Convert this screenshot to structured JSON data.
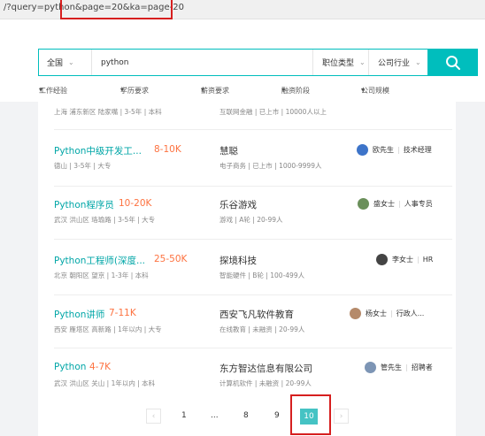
{
  "address_bar": {
    "url": "/?query=python&page=20&ka=page-20"
  },
  "search": {
    "city": "全国",
    "query": "python",
    "job_type": "职位类型",
    "industry": "公司行业",
    "icons": {
      "chevron": "chevron-down-icon",
      "search": "search-icon"
    }
  },
  "filters": [
    "工作经验",
    "学历要求",
    "薪资要求",
    "融资阶段",
    "公司规模"
  ],
  "partial_job": {
    "meta": "上海 浦东新区 陆家嘴 | 3-5年 | 本科",
    "company_meta": "互联网金融 | 已上市 | 10000人以上"
  },
  "jobs": [
    {
      "title": "Python中级开发工...",
      "salary": "8-10K",
      "location": "德山",
      "experience": "3-5年",
      "education": "大专",
      "company": "慧聪",
      "industry": "电子商务",
      "stage": "已上市",
      "size": "1000-9999人",
      "recruiter": "欧先生",
      "role": "技术经理",
      "avatar_color": "#3d74c9"
    },
    {
      "title": "Python程序员",
      "salary": "10-20K",
      "location": "武汉 洪山区 珞瑜路",
      "experience": "3-5年",
      "education": "大专",
      "company": "乐谷游戏",
      "industry": "游戏",
      "stage": "A轮",
      "size": "20-99人",
      "recruiter": "盛女士",
      "role": "人事专员",
      "avatar_color": "#6a8f5a"
    },
    {
      "title": "Python工程师(深度...",
      "salary": "25-50K",
      "location": "北京 朝阳区 望京",
      "experience": "1-3年",
      "education": "本科",
      "company": "探境科技",
      "industry": "智能硬件",
      "stage": "B轮",
      "size": "100-499人",
      "recruiter": "李女士",
      "role": "HR",
      "avatar_color": "#444444"
    },
    {
      "title": "Python讲师",
      "salary": "7-11K",
      "location": "西安 雁塔区 高新路",
      "experience": "1年以内",
      "education": "大专",
      "company": "西安飞凡软件教育",
      "industry": "在线教育",
      "stage": "未融资",
      "size": "20-99人",
      "recruiter": "杨女士",
      "role": "行政人...",
      "avatar_color": "#b58a6a"
    },
    {
      "title": "Python",
      "salary": "4-7K",
      "location": "武汉 洪山区 关山",
      "experience": "1年以内",
      "education": "本科",
      "company": "东方智达信息有限公司",
      "industry": "计算机软件",
      "stage": "未融资",
      "size": "20-99人",
      "recruiter": "管先生",
      "role": "招聘者",
      "avatar_color": "#7d95b5"
    }
  ],
  "pagination": {
    "prev": "‹",
    "next": "›",
    "pages": [
      "1",
      "...",
      "8",
      "9"
    ],
    "current": "10"
  },
  "annotation_color": "#d61f1f"
}
